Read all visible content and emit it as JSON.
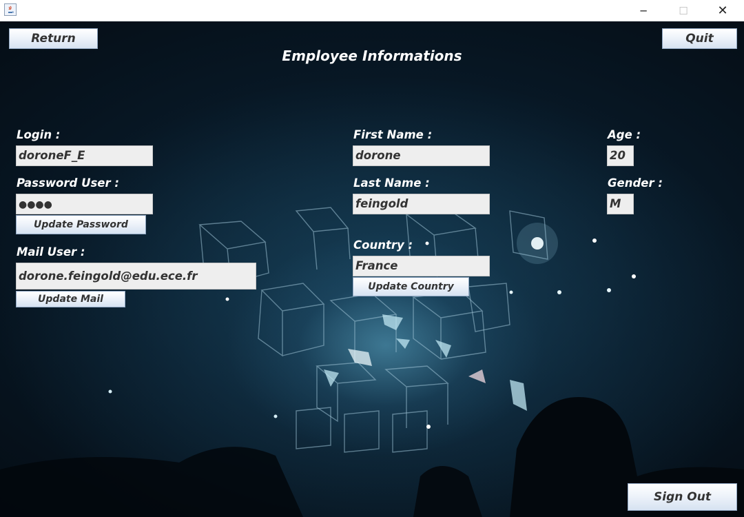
{
  "window": {
    "app_icon": "java-icon",
    "controls": {
      "minimize": "─",
      "maximize": "☐",
      "close": "✕"
    }
  },
  "header": {
    "title": "Employee Informations",
    "return_label": "Return",
    "quit_label": "Quit"
  },
  "left": {
    "login_label": "Login :",
    "login_value": "doroneF_E",
    "password_label": "Password User :",
    "password_value": "●●●●",
    "update_password_label": "Update Password",
    "mail_label": "Mail User :",
    "mail_value": "dorone.feingold@edu.ece.fr",
    "update_mail_label": "Update Mail"
  },
  "middle": {
    "first_name_label": "First Name :",
    "first_name_value": "dorone",
    "last_name_label": "Last Name :",
    "last_name_value": "feingold",
    "country_label": "Country :",
    "country_value": "France",
    "update_country_label": "Update Country"
  },
  "right": {
    "age_label": "Age :",
    "age_value": "20",
    "gender_label": "Gender :",
    "gender_value": "M"
  },
  "footer": {
    "sign_out_label": "Sign Out"
  },
  "colors": {
    "background_dark": "#06121c",
    "field_bg": "#eeeeee",
    "button_gradient_bottom": "#d6e2f1",
    "label_text": "#ffffff"
  }
}
